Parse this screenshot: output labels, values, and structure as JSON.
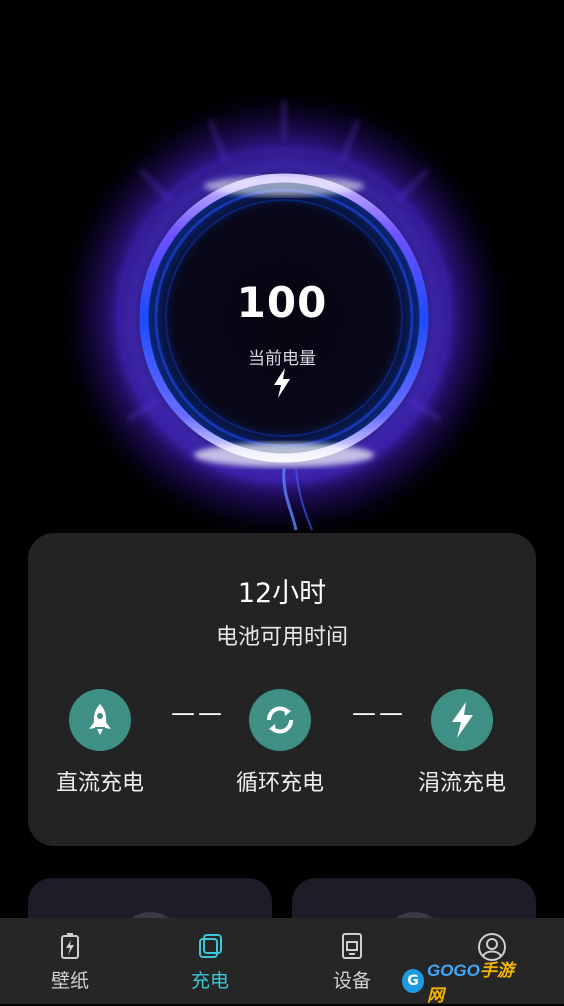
{
  "battery": {
    "level": "100",
    "level_label": "当前电量"
  },
  "card": {
    "hours": "12小时",
    "subtitle": "电池可用时间",
    "dash": "——",
    "modes": [
      {
        "label": "直流充电",
        "icon": "rocket-icon"
      },
      {
        "label": "循环充电",
        "icon": "cycle-icon"
      },
      {
        "label": "涓流充电",
        "icon": "lightning-icon"
      }
    ]
  },
  "tabs": [
    {
      "label": "壁纸",
      "icon": "battery-icon"
    },
    {
      "label": "充电",
      "icon": "layers-icon",
      "active": true
    },
    {
      "label": "设备",
      "icon": "device-icon"
    },
    {
      "label": "",
      "icon": "profile-icon"
    }
  ],
  "watermark": {
    "text": "GOGO",
    "text_cn": "手游网"
  },
  "colors": {
    "accent": "#3cc6d8",
    "mode_circle": "#3f8f84",
    "card_bg": "#232323",
    "tabbar_bg": "#262626"
  }
}
